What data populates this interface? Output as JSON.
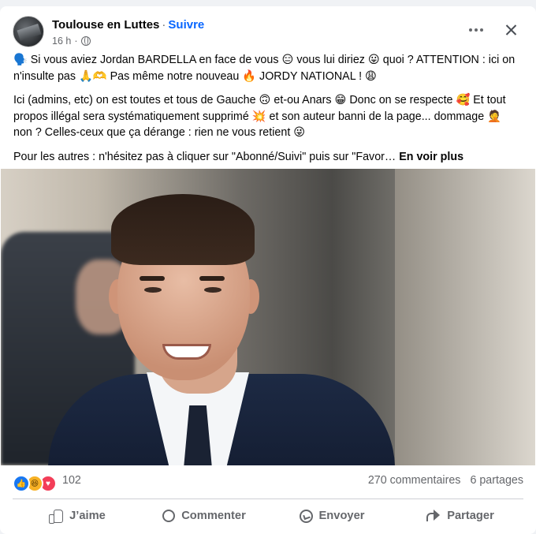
{
  "post": {
    "page_name": "Toulouse en Luttes",
    "separator": "·",
    "follow_label": "Suivre",
    "time": "16 h",
    "audience_icon": "globe-icon",
    "paragraphs": [
      "🗣️ Si vous aviez Jordan BARDELLA en face de vous 😑 vous lui diriez 😛 quoi ? ATTENTION : ici on n'insulte pas 🙏🫶 Pas même notre nouveau 🔥 JORDY NATIONAL ! 😩",
      "Ici (admins, etc) on est toutes et tous de Gauche 🙃 et-ou Anars 😁 Donc on se respecte 🥰 Et tout propos illégal sera systématiquement supprimé 💥 et son auteur banni de la page... dommage 🤦 non ? Celles-ceux que ça dérange : rien ne vous retient 😜"
    ],
    "truncated_text": "Pour les autres : n'hésitez pas à cliquer sur \"Abonné/Suivi\" puis sur \"Favor…",
    "see_more_label": "En voir plus"
  },
  "stats": {
    "reaction_icons": [
      "like-icon",
      "haha-icon",
      "love-icon"
    ],
    "reaction_count": "102",
    "comments": "270 commentaires",
    "shares": "6 partages"
  },
  "actions": {
    "like": "J’aime",
    "comment": "Commenter",
    "send": "Envoyer",
    "share": "Partager"
  },
  "colors": {
    "accent": "#0866ff",
    "secondary_text": "#65676b",
    "background": "#f0f2f5"
  }
}
